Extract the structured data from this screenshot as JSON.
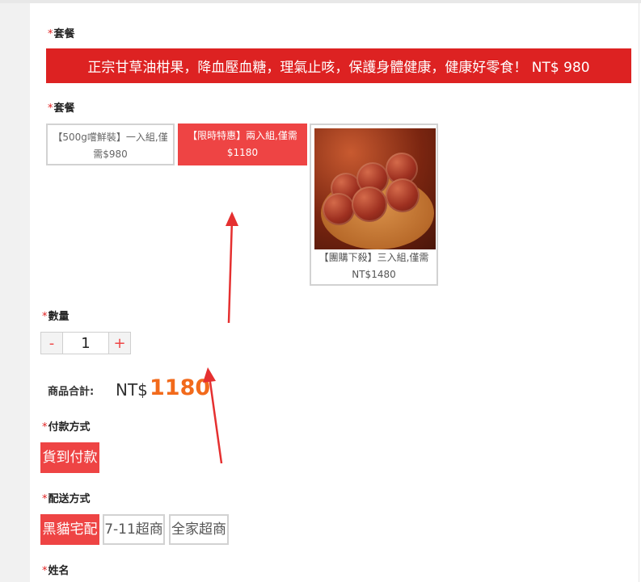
{
  "package_label": "套餐",
  "banner_text": "正宗甘草油柑果，降血壓血糖，理氣止咳，保護身體健康，健康好零食！ NT$ 980",
  "package_label_2": "套餐",
  "options": [
    {
      "line1": "【500g嚐鮮裝】一入組,僅",
      "line2": "需$980",
      "selected": false
    },
    {
      "line1": "【限時特惠】兩入組,僅需",
      "line2": "$1180",
      "selected": true
    },
    {
      "line1": "【團購下殺】三入組,僅需",
      "line2": "NT$1480",
      "selected": false,
      "image": "candied-fruit-photo"
    }
  ],
  "quantity": {
    "label": "數量",
    "minus": "-",
    "value": "1",
    "plus": "+"
  },
  "total": {
    "label": "商品合計:",
    "currency": "NT$",
    "value": "1180"
  },
  "payment": {
    "label": "付款方式",
    "options": [
      {
        "label": "貨到付款",
        "selected": true
      }
    ]
  },
  "shipping": {
    "label": "配送方式",
    "options": [
      {
        "label": "黑貓宅配",
        "selected": true
      },
      {
        "label": "7-11超商",
        "selected": false
      },
      {
        "label": "全家超商",
        "selected": false
      }
    ]
  },
  "name_label": "姓名",
  "colors": {
    "accent": "#ee4444",
    "banner": "#dd2222",
    "price": "#f26a1b",
    "annotation_arrow": "#e53030"
  }
}
